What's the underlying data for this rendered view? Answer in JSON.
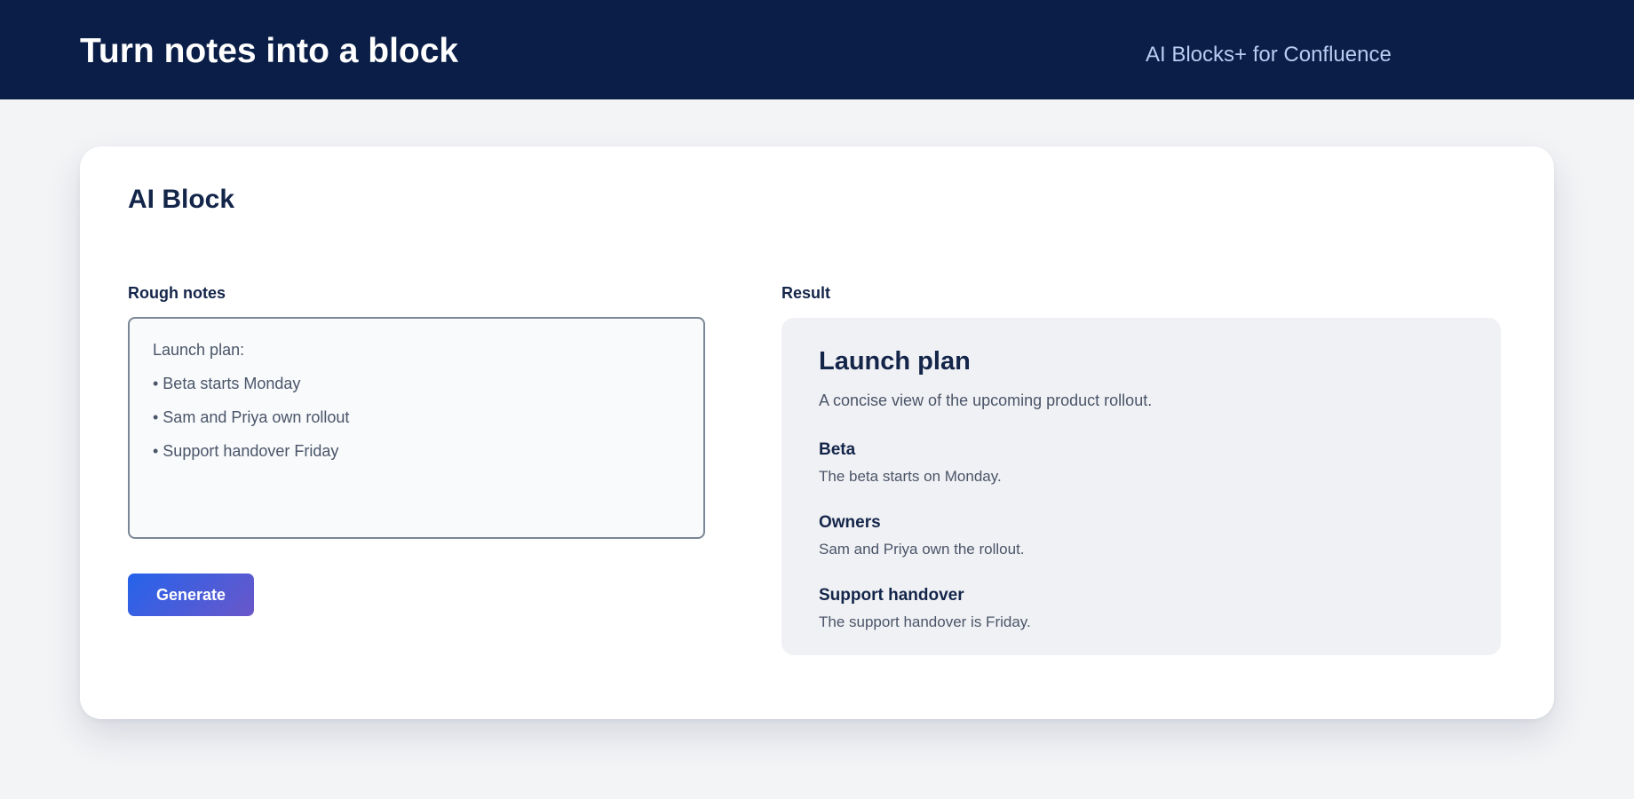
{
  "header": {
    "title": "Turn notes into a block",
    "brand": "AI Blocks+ for Confluence"
  },
  "card": {
    "title": "AI Block",
    "notes_label": "Rough notes",
    "notes_lines": [
      "Launch plan:",
      "• Beta starts Monday",
      "• Sam and Priya own rollout",
      "• Support handover Friday"
    ],
    "generate_label": "Generate",
    "result_label": "Result"
  },
  "result": {
    "title": "Launch plan",
    "subtitle": "A concise view of the upcoming product rollout.",
    "sections": [
      {
        "heading": "Beta",
        "text": "The beta starts on Monday."
      },
      {
        "heading": "Owners",
        "text": "Sam and Priya own the rollout."
      },
      {
        "heading": "Support handover",
        "text": "The support handover is Friday."
      }
    ]
  },
  "colors": {
    "header_bg": "#0a1e48",
    "accent_start": "#2563eb",
    "accent_end": "#6a57c9",
    "page_bg": "#f3f4f6"
  }
}
